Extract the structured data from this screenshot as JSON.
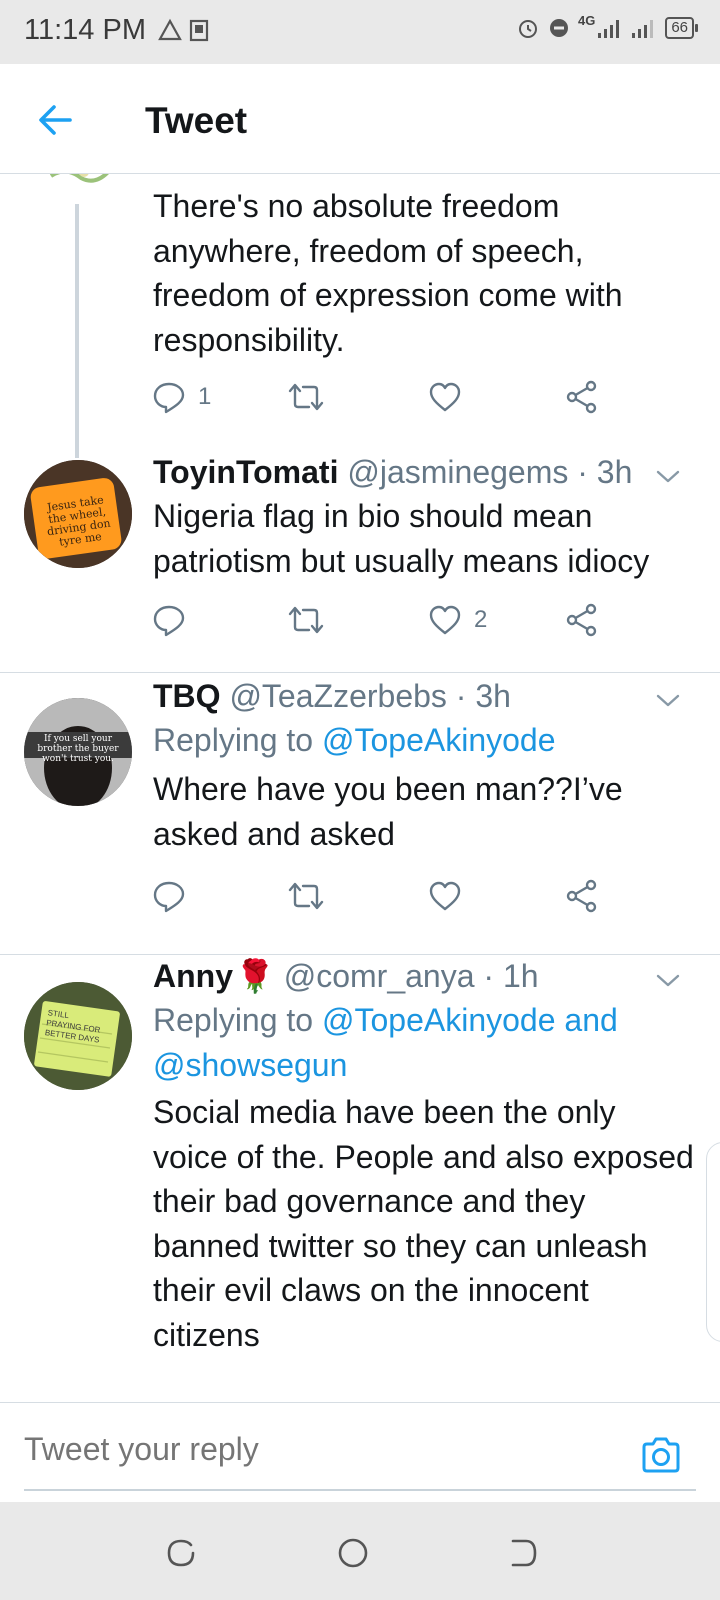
{
  "status_bar": {
    "time": "11:14 PM",
    "network": "4G",
    "battery": "66",
    "icons": [
      "alert-icon",
      "pdf-icon",
      "alarm-icon",
      "dnd-icon",
      "signal-icon",
      "signal-icon-2",
      "battery-icon"
    ]
  },
  "header": {
    "title": "Tweet",
    "back_icon": "arrow-left-icon"
  },
  "colors": {
    "accent": "#1da1f2",
    "mention": "#1b95e0",
    "secondary_text": "#657786",
    "primary_text": "#14171a",
    "divider": "#d6dde3",
    "system_bar": "#e9e9e9"
  },
  "tweets": [
    {
      "body": "There's no absolute freedom anywhere, freedom of speech, freedom of expression come with responsibility.",
      "replies_count": "1",
      "likes_count": ""
    },
    {
      "name": "ToyinTomati",
      "handle": "@jasminegems",
      "time": "· 3h",
      "body": "Nigeria flag in bio should mean patriotism but usually means idiocy",
      "replies_count": "",
      "likes_count": "2",
      "avatar_text": "Jesus take the wheel, driving don tyre me"
    },
    {
      "name": "TBQ",
      "handle": "@TeaZzerbebs",
      "time": "· 3h",
      "replying_prefix": "Replying to",
      "replying_to": "@TopeAkinyode",
      "body": "Where have you been man??I’ve asked and asked",
      "avatar_text": "If you sell your brother the buyer won't trust you."
    },
    {
      "name": "Anny",
      "emoji": "🌹",
      "handle": "@comr_anya",
      "time": "· 1h",
      "replying_prefix": "Replying to",
      "replying_to": "@TopeAkinyode and @showsegun",
      "body": "Social media have been the only voice of the. People and also exposed their bad governance and they banned twitter so they can unleash their evil claws on the innocent citizens",
      "avatar_text": "STILL PRAYING FOR BETTER DAYS"
    }
  ],
  "reply_bar": {
    "placeholder": "Tweet your reply",
    "camera_icon": "camera-icon"
  },
  "nav_bar": {
    "icons": [
      "recents-icon",
      "home-icon",
      "back-icon"
    ]
  }
}
